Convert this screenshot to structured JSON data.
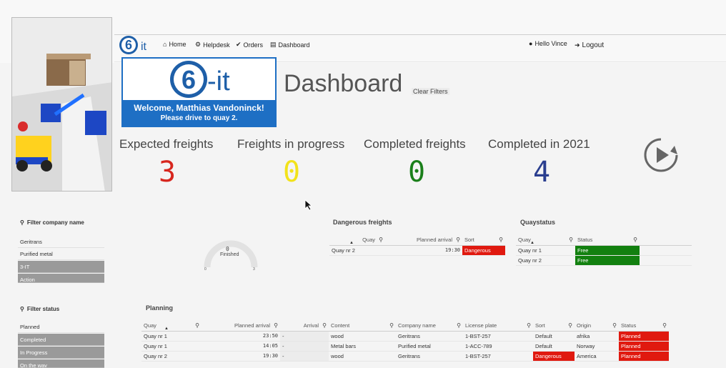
{
  "nav": {
    "brand": "6-it",
    "home": "Home",
    "helpdesk": "Helpdesk",
    "orders": "Orders",
    "dashboard": "Dashboard",
    "user_greeting": "Hello Vince",
    "logout": "Logout"
  },
  "welcome": {
    "logo_text": "6-it",
    "line1": "Welcome, Matthias Vandoninck!",
    "line2": "Please drive to quay 2."
  },
  "page": {
    "title": "Dashboard",
    "clear_filters": "Clear Filters"
  },
  "kpis": [
    {
      "label": "Expected freights",
      "value": "3",
      "color": "#d7261e"
    },
    {
      "label": "Freights in progress",
      "value": "0",
      "color": "#f2e21a"
    },
    {
      "label": "Completed freights",
      "value": "0",
      "color": "#1a7f1a"
    },
    {
      "label": "Completed in 2021",
      "value": "4",
      "color": "#2a3e8f"
    }
  ],
  "filter_company": {
    "title": "Filter company name",
    "items": [
      "Geritrans",
      "Purified metal",
      "3-IT",
      "Action"
    ]
  },
  "filter_status": {
    "title": "Filter status",
    "items": [
      "Planned",
      "Completed",
      "In Progress",
      "On the way"
    ]
  },
  "gauge": {
    "value": "0",
    "label": "Finished",
    "min": "0",
    "max": "3"
  },
  "dangerous": {
    "title": "Dangerous freights",
    "columns": [
      "Quay",
      "Planned arrival",
      "Sort"
    ],
    "rows": [
      {
        "quay": "Quay nr 2",
        "planned": "19:30",
        "sort": "Dangerous"
      }
    ]
  },
  "quaystatus": {
    "title": "Quaystatus",
    "columns": [
      "Quay",
      "Status"
    ],
    "rows": [
      {
        "quay": "Quay nr 1",
        "status": "Free"
      },
      {
        "quay": "Quay nr 2",
        "status": "Free"
      }
    ]
  },
  "planning": {
    "title": "Planning",
    "columns": [
      "Quay",
      "Planned arrival",
      "Arrival",
      "Content",
      "Company name",
      "License plate",
      "Sort",
      "Origin",
      "Status"
    ],
    "rows": [
      {
        "quay": "Quay nr 1",
        "planned": "23:50",
        "arrival": "-",
        "content": "wood",
        "company": "Geritrans",
        "plate": "1-BST-257",
        "sort": "Default",
        "origin": "afrika",
        "status": "Planned"
      },
      {
        "quay": "Quay nr 1",
        "planned": "14:05",
        "arrival": "-",
        "content": "Metal bars",
        "company": "Purified metal",
        "plate": "1-ACC-789",
        "sort": "Default",
        "origin": "Norway",
        "status": "Planned"
      },
      {
        "quay": "Quay nr 2",
        "planned": "19:30",
        "arrival": "-",
        "content": "wood",
        "company": "Geritrans",
        "plate": "1-BST-257",
        "sort": "Dangerous",
        "origin": "America",
        "status": "Planned"
      }
    ]
  },
  "colors": {
    "accent": "#1e6fc4",
    "danger": "#e0190f",
    "ok": "#12800f",
    "filter_selected": "#9a9a9a"
  }
}
